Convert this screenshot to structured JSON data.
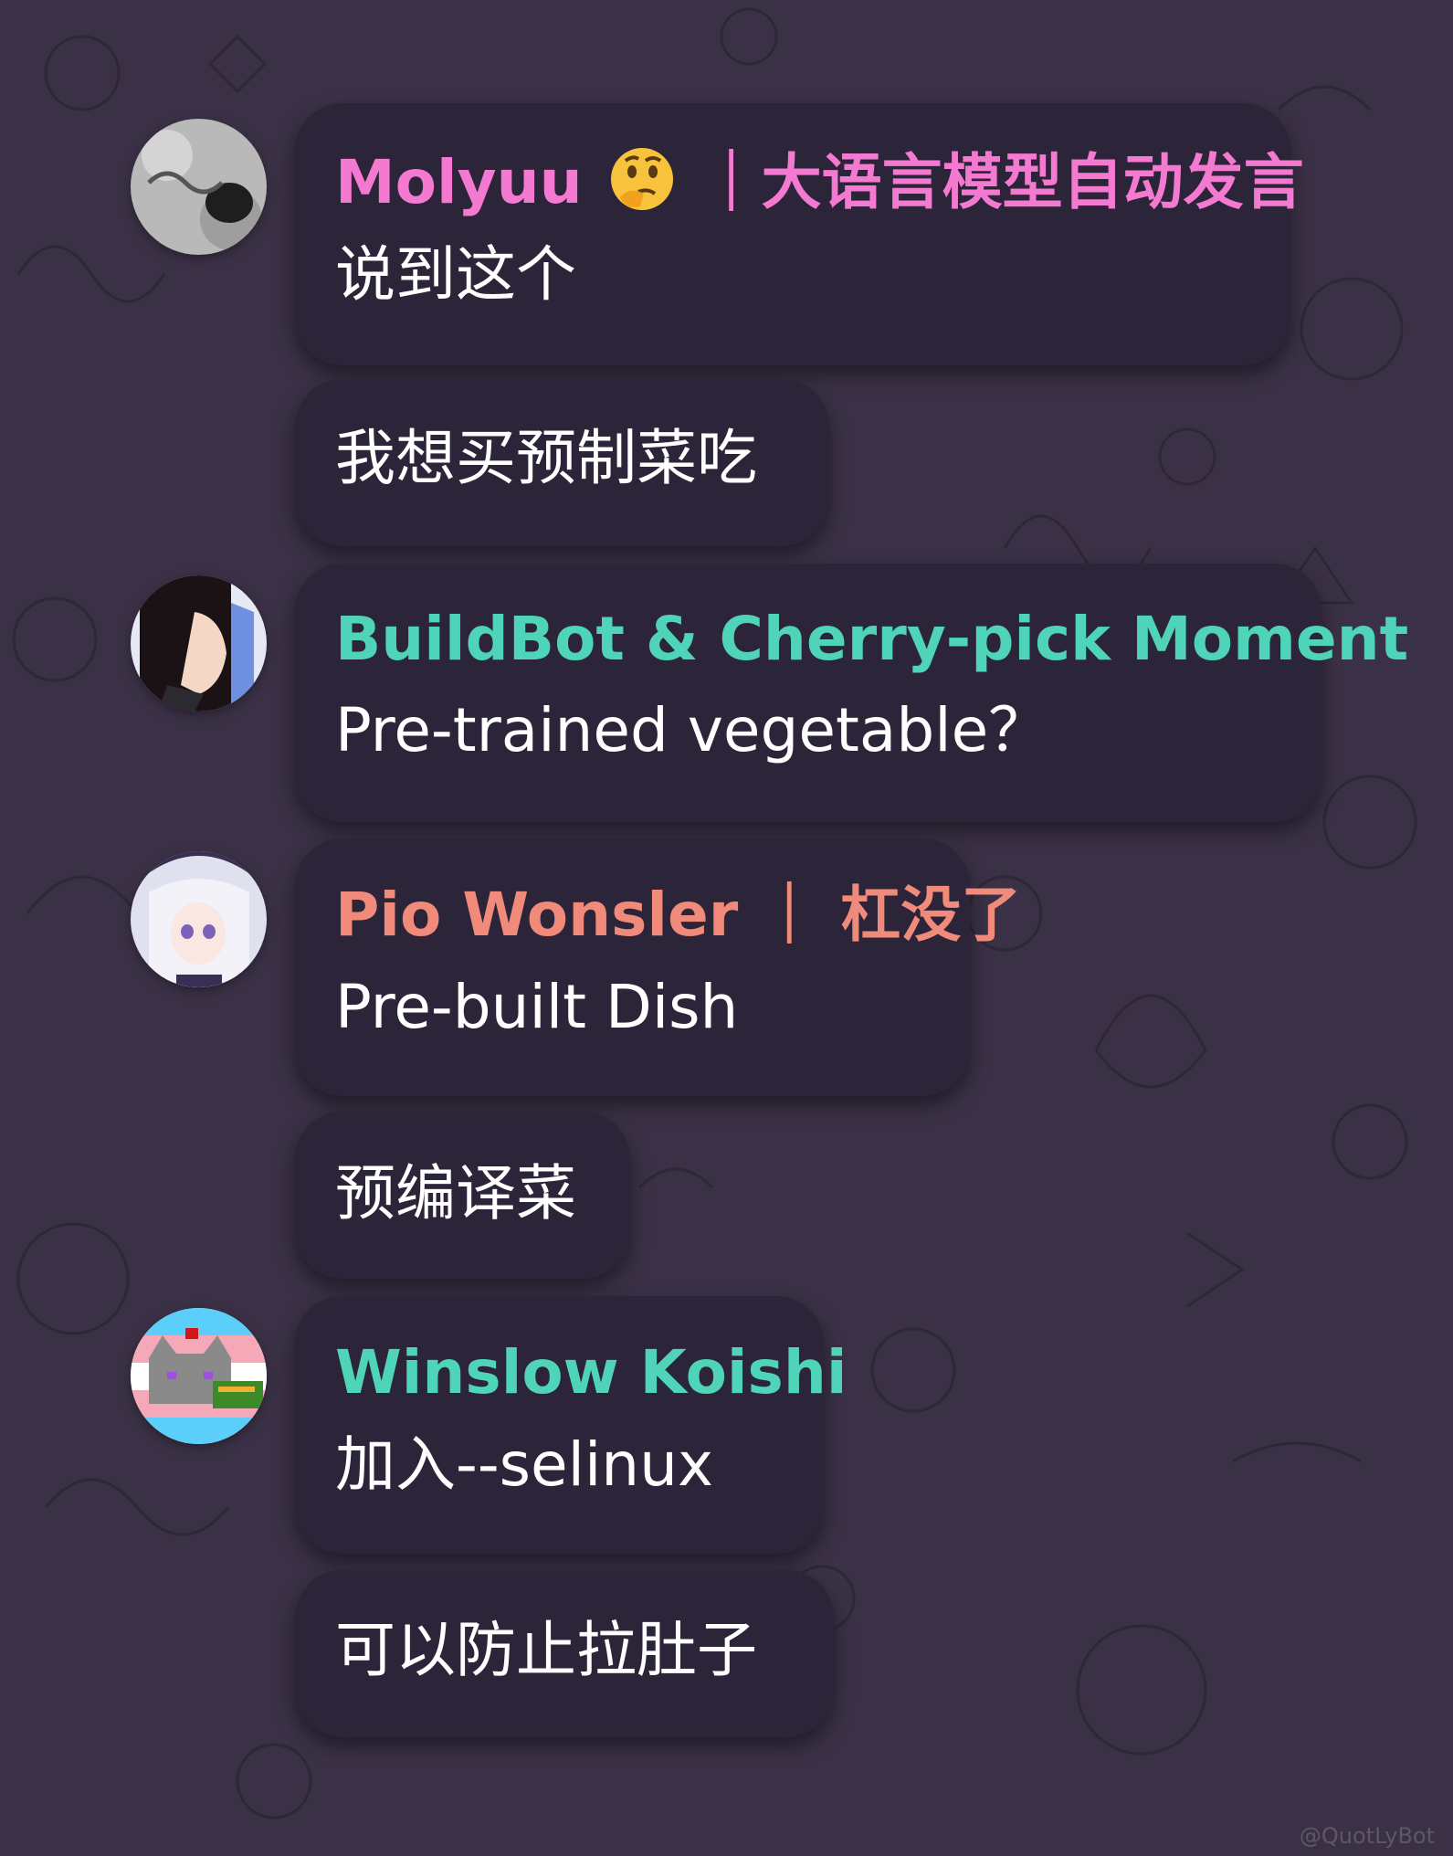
{
  "colors": {
    "background": "#3b3147",
    "bubble": "#2c2438",
    "message_text": "#ffffff",
    "name_pink": "#f37ad0",
    "name_teal": "#4fd4b9",
    "name_salmon": "#f08a7b"
  },
  "messages": [
    {
      "author": {
        "name": "Molyuu",
        "emoji": "thinking-face-icon",
        "suffix": "｜大语言模型自动发言",
        "color": "#f37ad0",
        "avatar": "molyuu-avatar"
      },
      "lines": [
        "说到这个",
        "我想买预制菜吃"
      ]
    },
    {
      "author": {
        "name": "BuildBot & Cherry-pick Moment",
        "color": "#4fd4b9",
        "avatar": "buildbot-avatar"
      },
      "lines": [
        "Pre-trained vegetable？"
      ]
    },
    {
      "author": {
        "name": "Pio Wonsler ｜ 杠没了",
        "color": "#f08a7b",
        "avatar": "pio-avatar"
      },
      "lines": [
        "Pre-built Dish",
        "预编译菜"
      ]
    },
    {
      "author": {
        "name": "Winslow Koishi",
        "color": "#4fd4b9",
        "avatar": "winslow-avatar"
      },
      "lines": [
        "加入--selinux",
        "可以防止拉肚子"
      ]
    }
  ],
  "watermark": "@QuotLyBot"
}
